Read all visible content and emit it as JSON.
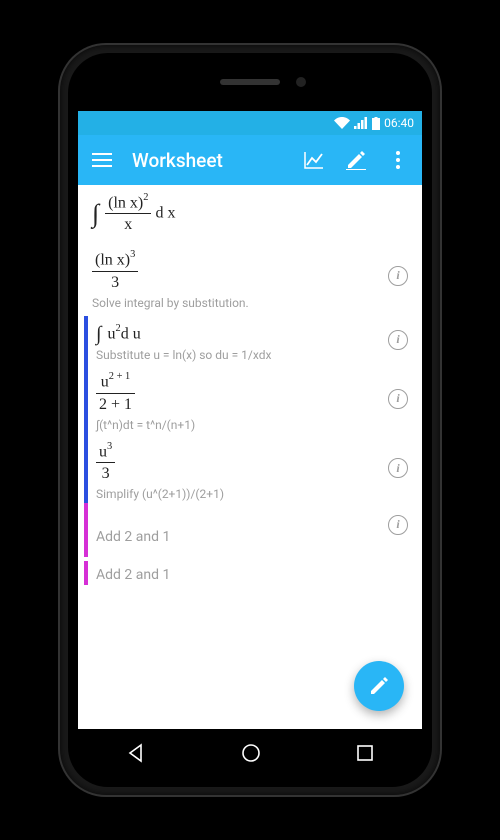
{
  "status": {
    "time": "06:40"
  },
  "appbar": {
    "title": "Worksheet"
  },
  "rows": {
    "r0": {
      "expr_num_base": "(ln x)",
      "expr_num_exp": "2",
      "expr_den": "x",
      "dx": "d x"
    },
    "r1": {
      "expr_num_base": "(ln x)",
      "expr_num_exp": "3",
      "expr_den": "3",
      "hint": "Solve integral by substitution."
    },
    "r2": {
      "expr_base": "u",
      "expr_exp": "2",
      "du": "d u",
      "hint": "Substitute u = ln(x) so du = 1/xdx"
    },
    "r3": {
      "expr_num_base": "u",
      "expr_num_exp": "2 + 1",
      "expr_den": "2 + 1",
      "hint": "∫(t^n)dt = t^n/(n+1)"
    },
    "r4": {
      "expr_num_base": "u",
      "expr_num_exp": "3",
      "expr_den": "3",
      "hint": "Simplify (u^(2+1))/(2+1)"
    },
    "r5": {
      "hint": "Add 2 and 1"
    },
    "r6": {
      "hint": "Add 2 and 1"
    }
  }
}
